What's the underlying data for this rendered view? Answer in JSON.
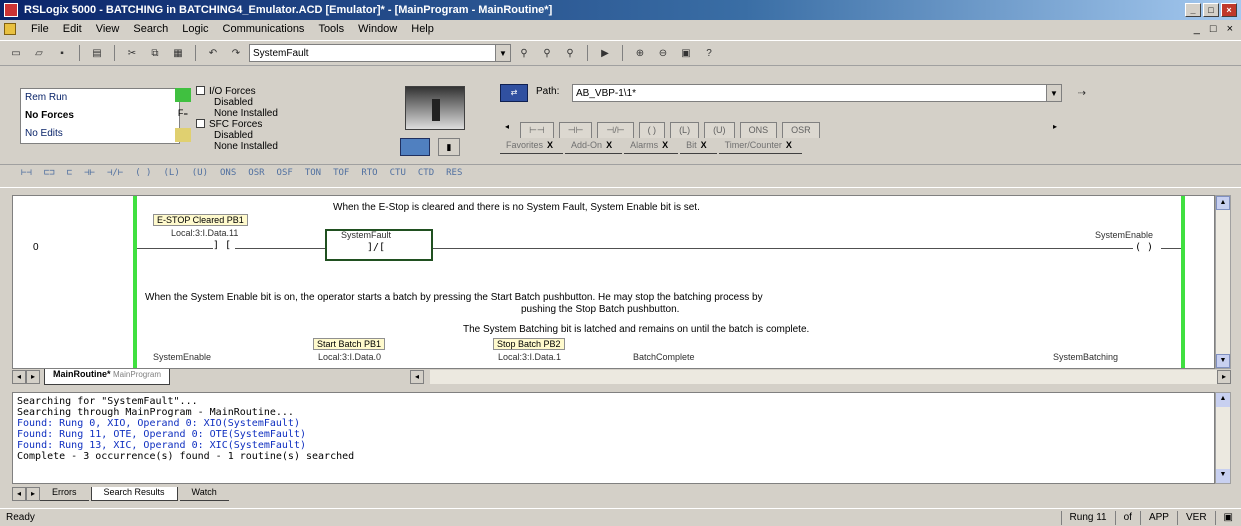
{
  "window": {
    "title": "RSLogix 5000 - BATCHING in BATCHING4_Emulator.ACD [Emulator]* - [MainProgram - MainRoutine*]",
    "minimize": "_",
    "maximize": "□",
    "close": "×"
  },
  "menu": {
    "items": [
      "File",
      "Edit",
      "View",
      "Search",
      "Logic",
      "Communications",
      "Tools",
      "Window",
      "Help"
    ],
    "mdi_min": "_",
    "mdi_max": "□",
    "mdi_close": "×"
  },
  "toolbar1": {
    "search_value": "SystemFault"
  },
  "controller_status": {
    "rows": [
      "Rem Run",
      "No Forces",
      "No Edits"
    ],
    "io_forces": "I/O Forces",
    "io_forces_state1": "Disabled",
    "io_forces_state2": "None Installed",
    "sfc_forces": "SFC Forces",
    "sfc_forces_state1": "Disabled",
    "sfc_forces_state2": "None Installed"
  },
  "path": {
    "label": "Path:",
    "value": "AB_VBP-1\\1*"
  },
  "instruction_tabs": [
    "Favorites",
    "Add-On",
    "Alarms",
    "Bit",
    "Timer/Counter"
  ],
  "ladder": {
    "rung0_number": "0",
    "rung0_comment": "When the E-Stop is cleared and there is no System Fault, System Enable bit is set.",
    "estop_label": "E-STOP Cleared PB1",
    "estop_tag": "Local:3:I.Data.11",
    "estop_symbol": "] [",
    "fault_tag": "SystemFault",
    "fault_symbol": "]/[",
    "enable_tag": "SystemEnable",
    "enable_symbol": "( )",
    "rung1_comment_a": "When the System Enable bit is on, the operator starts a batch by pressing the Start Batch pushbutton. He may stop the batching process by",
    "rung1_comment_b": "pushing the Stop Batch pushbutton.",
    "rung1_comment_c": "The System Batching bit is latched and remains on until the batch is complete.",
    "start_label": "Start Batch PB1",
    "stop_label": "Stop Batch PB2",
    "r1_tag1": "SystemEnable",
    "r1_tag2": "Local:3:I.Data.0",
    "r1_tag3": "Local:3:I.Data.1",
    "r1_tag4": "BatchComplete",
    "r1_tag5": "SystemBatching"
  },
  "sheet_tab": {
    "name": "MainRoutine*",
    "sub": "MainProgram"
  },
  "output": {
    "lines": [
      "Searching for \"SystemFault\"...",
      "Searching through MainProgram - MainRoutine...",
      "Found: Rung 0, XIO, Operand 0: XIO(SystemFault)",
      "Found: Rung 11, OTE, Operand 0: OTE(SystemFault)",
      "Found: Rung 13, XIC, Operand 0: XIC(SystemFault)",
      "Complete - 3 occurrence(s) found - 1 routine(s) searched"
    ],
    "tabs": [
      "Errors",
      "Search Results",
      "Watch"
    ]
  },
  "statusbar": {
    "ready": "Ready",
    "rung": "Rung 11",
    "of": "of",
    "app": "APP",
    "ver": "VER"
  }
}
